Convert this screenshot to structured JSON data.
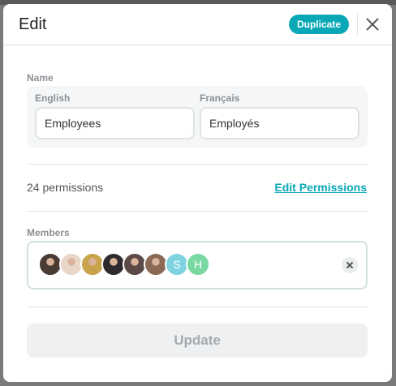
{
  "dialog": {
    "title": "Edit",
    "duplicate_label": "Duplicate",
    "close_icon": "close-icon"
  },
  "name": {
    "label": "Name",
    "english_label": "English",
    "english_value": "Employees",
    "french_label": "Français",
    "french_value": "Employés"
  },
  "permissions": {
    "count_text": "24 permissions",
    "edit_link": "Edit Permissions"
  },
  "members": {
    "label": "Members",
    "avatars": [
      {
        "type": "photo",
        "color": "#4a3b34"
      },
      {
        "type": "photo",
        "color": "#e8d6c8"
      },
      {
        "type": "photo",
        "color": "#c9a34a"
      },
      {
        "type": "photo",
        "color": "#2f2a2d"
      },
      {
        "type": "photo",
        "color": "#5b4a45"
      },
      {
        "type": "photo",
        "color": "#8a6a55"
      },
      {
        "type": "initial",
        "initial": "S",
        "color": "#7fd3e0"
      },
      {
        "type": "initial",
        "initial": "H",
        "color": "#7ad9a2"
      }
    ]
  },
  "update_label": "Update",
  "colors": {
    "accent": "#0aa8b7"
  }
}
